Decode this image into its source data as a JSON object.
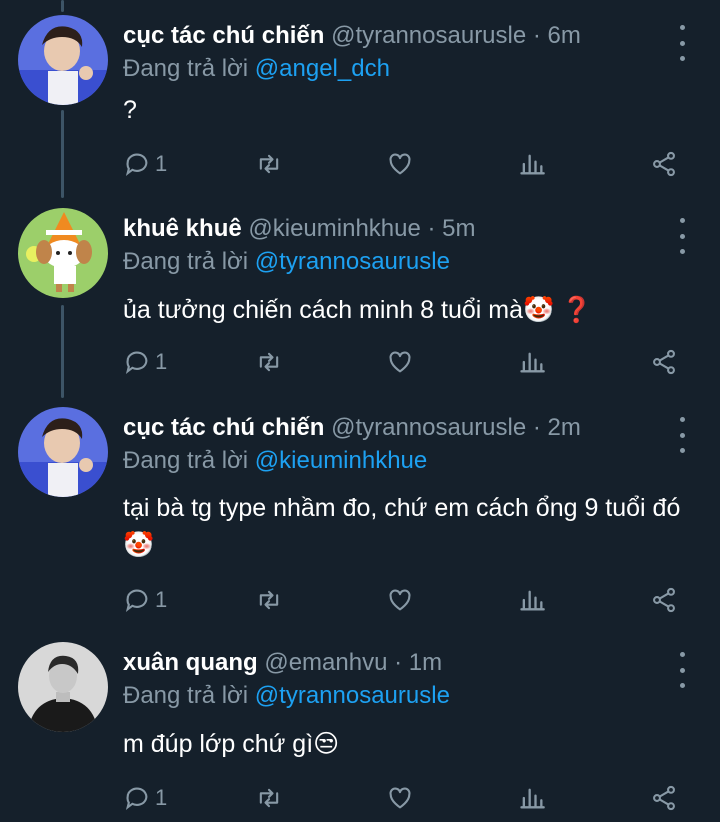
{
  "tweets": [
    {
      "name": "cục tác chú chiến",
      "handle": "@tyrannosaurusle",
      "time": "· 6m",
      "reply_prefix": "Đang trả lời ",
      "reply_to": "@angel_dch",
      "text": "?",
      "reply_count": "1"
    },
    {
      "name": "khuê khuê",
      "handle": "@kieuminhkhue",
      "time": "· 5m",
      "reply_prefix": "Đang trả lời ",
      "reply_to": "@tyrannosaurusle",
      "text": "ủa tưởng chiến cách minh 8 tuổi mà🤡 ❓",
      "reply_count": "1"
    },
    {
      "name": "cục tác chú chiến",
      "handle": "@tyrannosaurusle",
      "time": "· 2m",
      "reply_prefix": "Đang trả lời ",
      "reply_to": "@kieuminhkhue",
      "text": "tại bà tg type nhầm đo, chứ em cách ổng 9 tuổi đó🤡",
      "reply_count": "1"
    },
    {
      "name": "xuân quang",
      "handle": "@emanhvu",
      "time": "· 1m",
      "reply_prefix": "Đang trả lời ",
      "reply_to": "@tyrannosaurusle",
      "text": "m đúp lớp chứ gì😒",
      "reply_count": "1"
    }
  ],
  "colors": {
    "background": "#15202b",
    "secondary_text": "#8899a6",
    "link": "#1da1f2",
    "thread_line": "#3d5466"
  },
  "icons": [
    "reply-icon",
    "retweet-icon",
    "like-icon",
    "analytics-icon",
    "share-icon",
    "more-icon"
  ]
}
